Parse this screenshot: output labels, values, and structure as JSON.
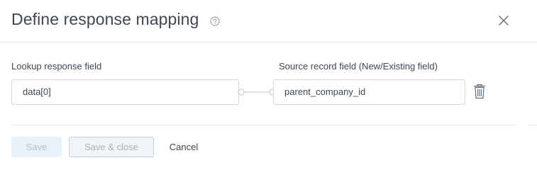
{
  "dialog": {
    "title": "Define response mapping",
    "help_icon": "help-circle-icon",
    "close_icon": "close-icon"
  },
  "mapping": {
    "lookup_label": "Lookup response field",
    "lookup_value": "data[0]",
    "source_label": "Source record field (New/Existing field)",
    "source_value": "parent_company_id",
    "delete_icon": "trash-icon",
    "connector_icon": "link-connector-icon"
  },
  "footer": {
    "save_label": "Save",
    "save_close_label": "Save & close",
    "cancel_label": "Cancel"
  },
  "colors": {
    "text": "#3d4752",
    "border": "#cfd7df",
    "divider": "#e3e7ec",
    "disabled_button_bg": "#e9f1f9"
  }
}
